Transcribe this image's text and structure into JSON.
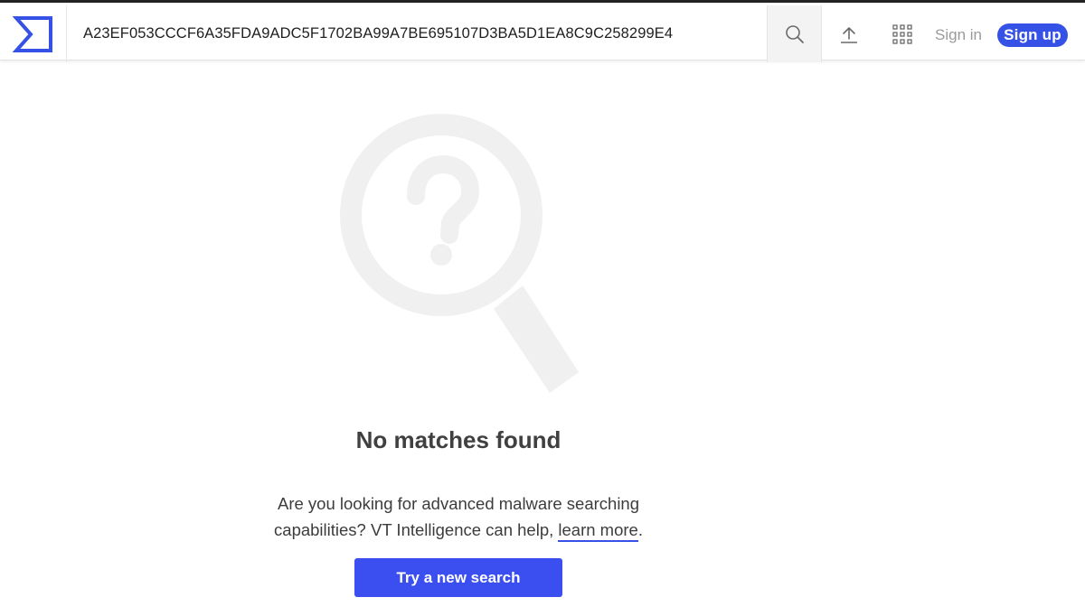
{
  "header": {
    "search_value": "A23EF053CCCF6A35FDA9ADC5F1702BA99A7BE695107D3BA5D1EA8C9C258299E4",
    "sign_in_label": "Sign in",
    "sign_up_label": "Sign up",
    "icons": {
      "logo": "virustotal-sigma-logo",
      "search": "search-icon",
      "upload": "upload-icon",
      "apps": "apps-grid-icon"
    }
  },
  "main": {
    "illustration_icon": "magnifier-question-icon",
    "heading": "No matches found",
    "message_prefix": "Are you looking for advanced malware searching capabilities? VT Intelligence can help, ",
    "learn_more_label": "learn more",
    "message_suffix": ".",
    "try_button_label": "Try a new search"
  },
  "colors": {
    "brand_blue": "#3652e6",
    "button_blue": "#3b4ff0",
    "illustration_gray": "#f0f0f0"
  }
}
